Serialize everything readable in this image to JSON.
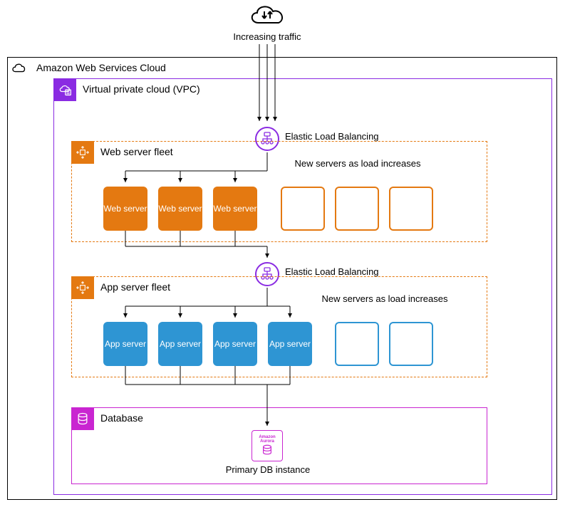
{
  "traffic": {
    "label": "Increasing traffic"
  },
  "aws": {
    "title": "Amazon Web Services Cloud"
  },
  "vpc": {
    "title": "Virtual private cloud (VPC)"
  },
  "elb1": {
    "label": "Elastic Load Balancing"
  },
  "elb2": {
    "label": "Elastic Load Balancing"
  },
  "webfleet": {
    "title": "Web server fleet",
    "servers": [
      "Web server",
      "Web server",
      "Web server"
    ],
    "new_label": "New servers as load increases"
  },
  "appfleet": {
    "title": "App server fleet",
    "servers": [
      "App server",
      "App server",
      "App server",
      "App server"
    ],
    "new_label": "New servers as load increases"
  },
  "database": {
    "title": "Database",
    "instance_small": "Amazon Aurora",
    "instance_label": "Primary DB instance"
  }
}
